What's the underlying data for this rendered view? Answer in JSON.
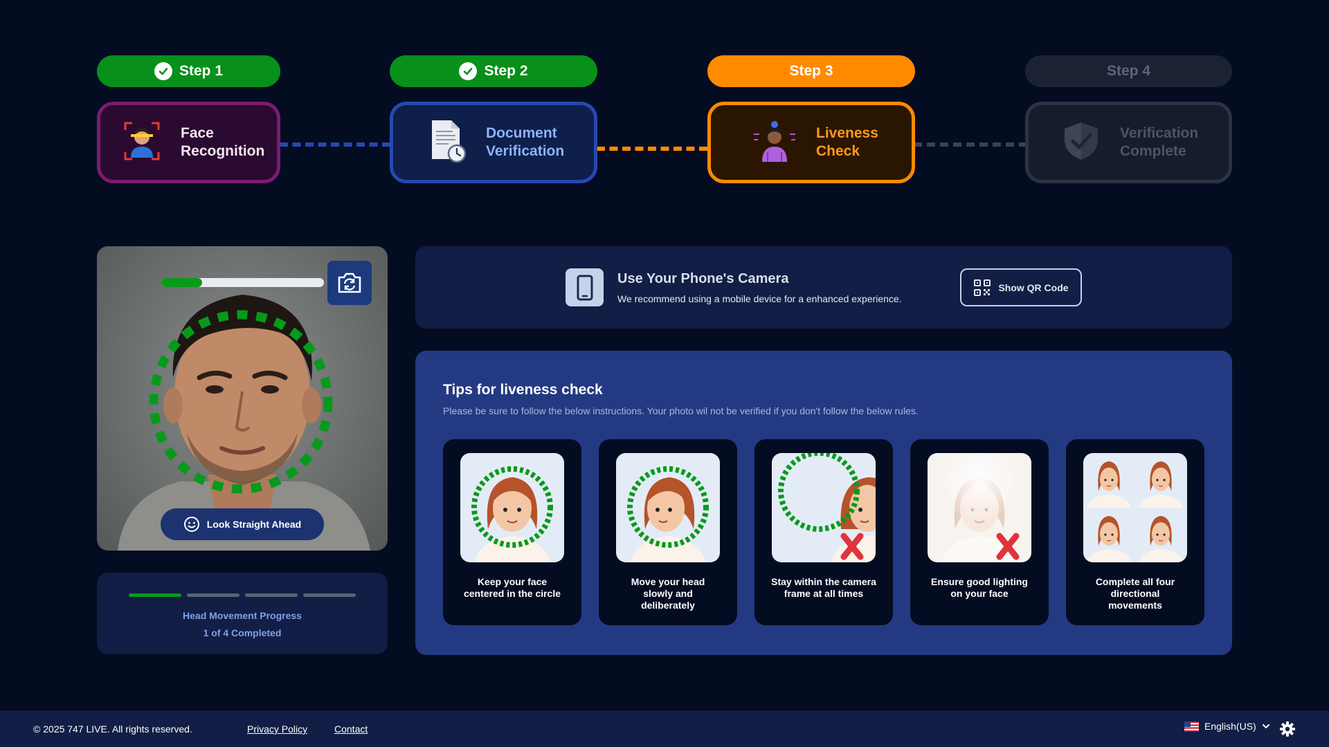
{
  "steps": [
    {
      "pill_label": "Step 1",
      "card_label_1": "Face",
      "card_label_2": "Recognition",
      "status": "done"
    },
    {
      "pill_label": "Step 2",
      "card_label_1": "Document",
      "card_label_2": "Verification",
      "status": "done"
    },
    {
      "pill_label": "Step 3",
      "card_label_1": "Liveness",
      "card_label_2": "Check",
      "status": "active"
    },
    {
      "pill_label": "Step 4",
      "card_label_1": "Verification",
      "card_label_2": "Complete",
      "status": "pending"
    }
  ],
  "camera": {
    "capture_progress": 0.25,
    "look_label": "Look Straight Ahead"
  },
  "movement": {
    "title": "Head Movement Progress",
    "count_text": "1 of 4 Completed",
    "completed": 1,
    "total": 4
  },
  "phone_banner": {
    "title": "Use Your Phone's Camera",
    "subtitle": "We recommend using a mobile device for a enhanced experience.",
    "qr_button": "Show QR Code"
  },
  "tips": {
    "title": "Tips for liveness check",
    "subtitle": "Please be sure to follow the below instructions. Your photo wil not be verified if you don't follow the below rules.",
    "items": [
      {
        "line1": "Keep your face",
        "line2": "centered in the circle",
        "line3": ""
      },
      {
        "line1": "Move your head",
        "line2": "slowly and",
        "line3": "deliberately"
      },
      {
        "line1": "Stay within the camera",
        "line2": "frame at all times",
        "line3": ""
      },
      {
        "line1": "Ensure good lighting",
        "line2": "on your face",
        "line3": ""
      },
      {
        "line1": "Complete all four",
        "line2": "directional",
        "line3": "movements"
      }
    ]
  },
  "footer": {
    "copyright": "© 2025 747 LIVE. All rights reserved.",
    "privacy": "Privacy Policy",
    "contact": "Contact",
    "language": "English(US)"
  },
  "colors": {
    "done": "#07901a",
    "active": "#ff8a00",
    "pending": "#1b2234",
    "background": "#040c22"
  }
}
